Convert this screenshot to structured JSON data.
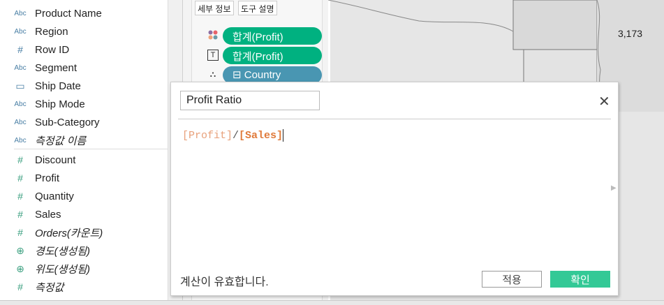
{
  "dimensions": [
    {
      "icon": "Abc",
      "label": "Product Name"
    },
    {
      "icon": "Abc",
      "label": "Region"
    },
    {
      "icon": "#",
      "label": "Row ID"
    },
    {
      "icon": "Abc",
      "label": "Segment"
    },
    {
      "icon": "calendar",
      "label": "Ship Date"
    },
    {
      "icon": "Abc",
      "label": "Ship Mode"
    },
    {
      "icon": "Abc",
      "label": "Sub-Category"
    },
    {
      "icon": "Abc",
      "label": "측정값 이름"
    }
  ],
  "measures": [
    {
      "icon": "#",
      "label": "Discount"
    },
    {
      "icon": "#",
      "label": "Profit"
    },
    {
      "icon": "#",
      "label": "Quantity"
    },
    {
      "icon": "#",
      "label": "Sales"
    },
    {
      "icon": "#",
      "label": "Orders(카운트)"
    },
    {
      "icon": "globe",
      "label": "경도(생성됨)"
    },
    {
      "icon": "globe",
      "label": "위도(생성됨)"
    },
    {
      "icon": "#",
      "label": "측정값"
    }
  ],
  "marks": {
    "detail_btn": "세부 정보",
    "tooltip_btn": "도구 설명",
    "pills": [
      {
        "icon": "color-icon",
        "label": "합계(Profit)",
        "color": "#00b180"
      },
      {
        "icon": "text-icon",
        "label": "합계(Profit)",
        "color": "#00b180"
      },
      {
        "icon": "hierarchy-icon",
        "label": "⊟ Country",
        "color": "#4996b2"
      }
    ]
  },
  "map": {
    "label": "3,173"
  },
  "dialog": {
    "name": "Profit Ratio",
    "formula": {
      "a": "[Profit]",
      "op": "/",
      "b": "[Sales]"
    },
    "status": "계산이 유효합니다.",
    "apply": "적용",
    "ok": "확인"
  }
}
